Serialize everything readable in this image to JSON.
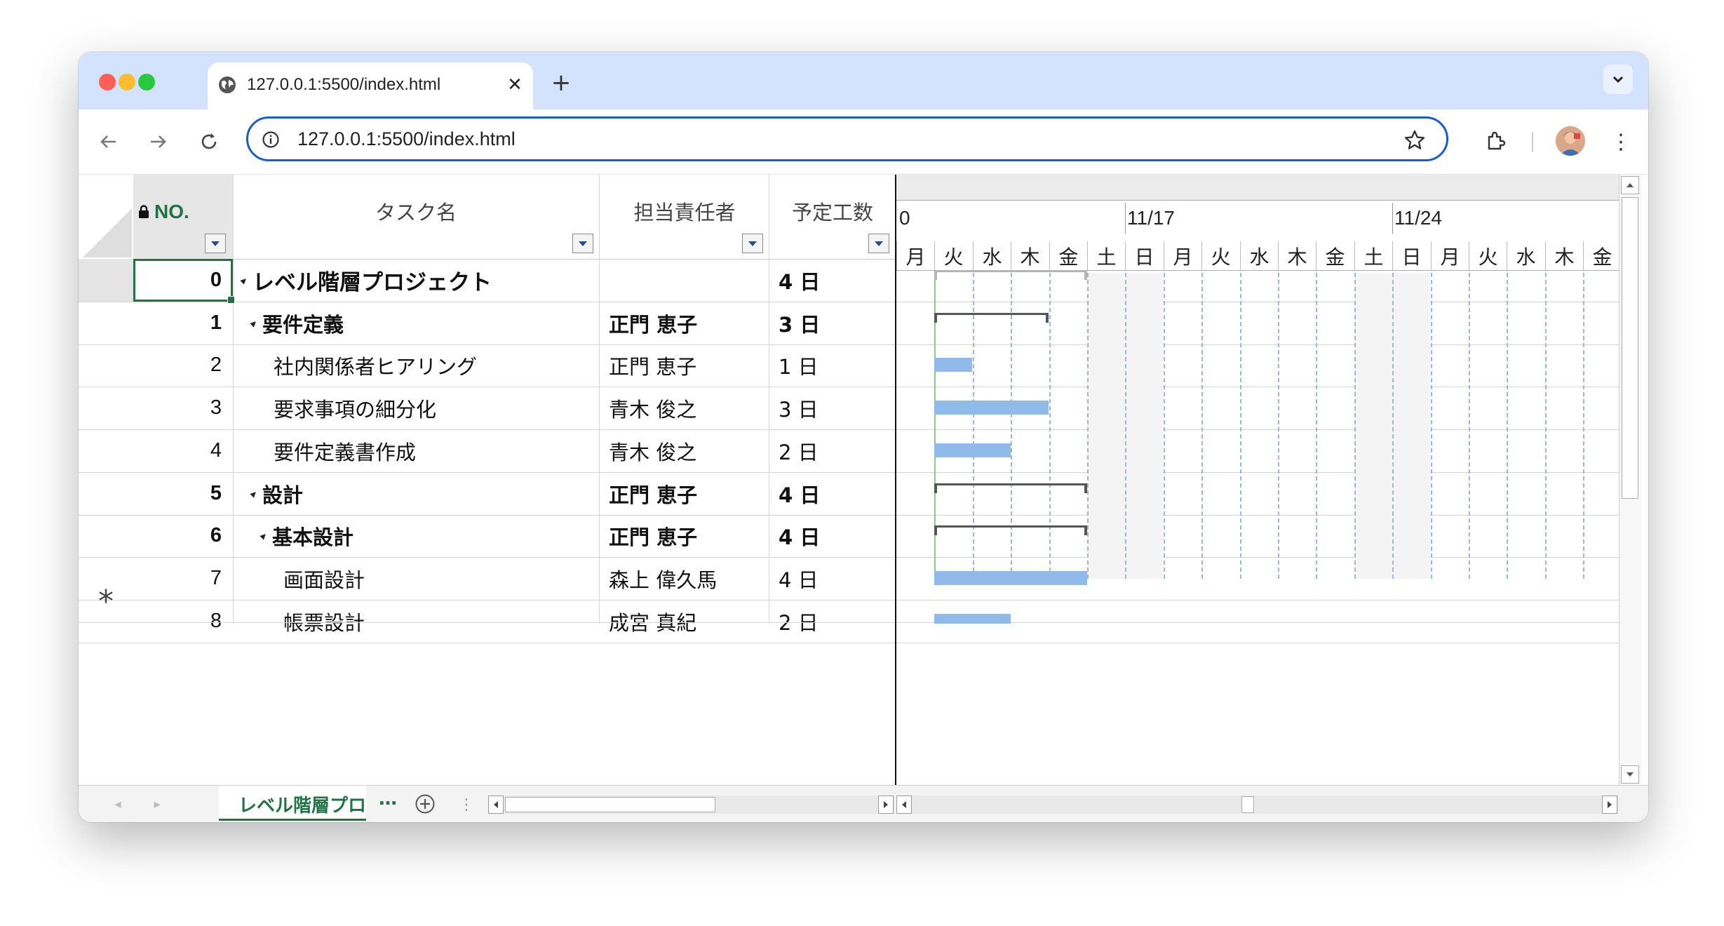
{
  "browser": {
    "tab_title": "127.0.0.1:5500/index.html",
    "url": "127.0.0.1:5500/index.html"
  },
  "grid": {
    "columns": [
      "NO.",
      "タスク名",
      "担当責任者",
      "予定工数"
    ],
    "rows": [
      {
        "no": "0",
        "task": "レベル階層プロジェクト",
        "owner": "",
        "effort": "4 日",
        "bold": true,
        "summary": true,
        "indent": 0,
        "start": 1,
        "dur": 4,
        "type": "project"
      },
      {
        "no": "1",
        "task": "要件定義",
        "owner": "正門 恵子",
        "effort": "3 日",
        "bold": true,
        "summary": true,
        "indent": 1,
        "start": 1,
        "dur": 3,
        "type": "summary"
      },
      {
        "no": "2",
        "task": "社内関係者ヒアリング",
        "owner": "正門 恵子",
        "effort": "1 日",
        "bold": false,
        "summary": false,
        "indent": 2,
        "start": 1,
        "dur": 1,
        "type": "task"
      },
      {
        "no": "3",
        "task": "要求事項の細分化",
        "owner": "青木 俊之",
        "effort": "3 日",
        "bold": false,
        "summary": false,
        "indent": 2,
        "start": 1,
        "dur": 3,
        "type": "task"
      },
      {
        "no": "4",
        "task": "要件定義書作成",
        "owner": "青木 俊之",
        "effort": "2 日",
        "bold": false,
        "summary": false,
        "indent": 2,
        "start": 1,
        "dur": 2,
        "type": "task"
      },
      {
        "no": "5",
        "task": "設計",
        "owner": "正門 恵子",
        "effort": "4 日",
        "bold": true,
        "summary": true,
        "indent": 1,
        "start": 1,
        "dur": 4,
        "type": "summary"
      },
      {
        "no": "6",
        "task": "基本設計",
        "owner": "正門 恵子",
        "effort": "4 日",
        "bold": true,
        "summary": true,
        "indent": 2,
        "start": 1,
        "dur": 4,
        "type": "summary"
      },
      {
        "no": "7",
        "task": "画面設計",
        "owner": "森上 偉久馬",
        "effort": "4 日",
        "bold": false,
        "summary": false,
        "indent": 3,
        "start": 1,
        "dur": 4,
        "type": "task"
      },
      {
        "no": "8",
        "task": "帳票設計",
        "owner": "成宮 真紀",
        "effort": "2 日",
        "bold": false,
        "summary": false,
        "indent": 3,
        "start": 1,
        "dur": 2,
        "type": "task"
      }
    ],
    "new_row_marker": "*"
  },
  "gantt": {
    "weeks": [
      "0",
      "11/17",
      "11/24"
    ],
    "days": [
      "月",
      "火",
      "水",
      "木",
      "金",
      "土",
      "日",
      "月",
      "火",
      "水",
      "木",
      "金",
      "土",
      "日",
      "月",
      "火",
      "水",
      "木",
      "金"
    ],
    "weekend_indices": [
      5,
      6,
      12,
      13
    ]
  },
  "sheet_tab": {
    "label": "レベル階層プロ",
    "more": "…"
  },
  "colors": {
    "accent_green": "#217346",
    "task_bar": "#8fbaea",
    "summary_bar": "#555555",
    "project_bar": "#b4b4b4",
    "url_border": "#1a5cc8"
  }
}
